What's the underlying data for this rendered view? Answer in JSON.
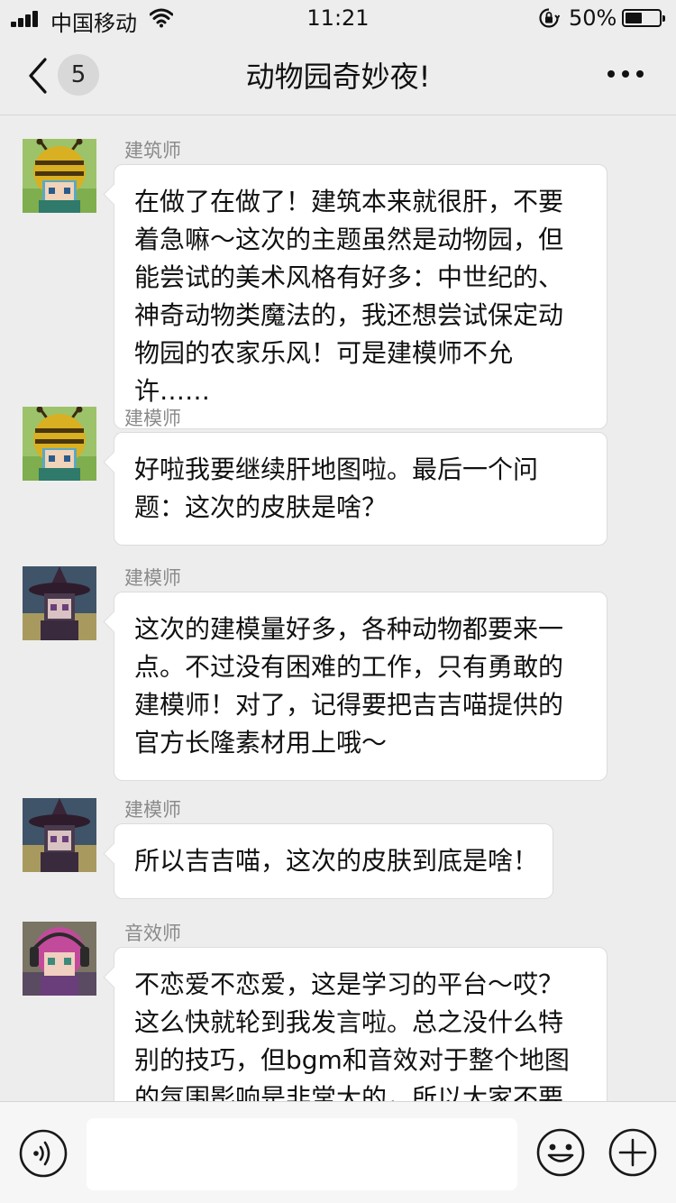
{
  "status_bar": {
    "carrier": "中国移动",
    "time": "11:21",
    "battery_percent": "50%",
    "battery_level": 0.5,
    "icons": [
      "signal-icon",
      "wifi-icon",
      "orientation-lock-icon",
      "battery-icon"
    ]
  },
  "nav": {
    "unread_badge": "5",
    "title": "动物园奇妙夜!",
    "icons": [
      "back-chevron-icon",
      "more-dots-icon"
    ]
  },
  "messages": [
    {
      "sender": "建筑师",
      "text": "在做了在做了！建筑本来就很肝，不要着急嘛～这次的主题虽然是动物园，但能尝试的美术风格有好多：中世纪的、神奇动物类魔法的，我还想尝试保定动物园的农家乐风！可是建模师不允许……",
      "avatar": "bee-helmet-avatar"
    },
    {
      "sender": "建模师",
      "text": "好啦我要继续肝地图啦。最后一个问题：这次的皮肤是啥？",
      "avatar": "bee-helmet-avatar"
    },
    {
      "sender": "建模师",
      "text": "这次的建模量好多，各种动物都要来一点。不过没有困难的工作，只有勇敢的建模师！对了，记得要把吉吉喵提供的官方长隆素材用上哦～",
      "avatar": "witch-hat-avatar"
    },
    {
      "sender": "建模师",
      "text": "所以吉吉喵，这次的皮肤到底是啥！",
      "avatar": "witch-hat-avatar"
    },
    {
      "sender": "音效师",
      "text": "不恋爱不恋爱，这是学习的平台～哎？这么快就轮到我发言啦。总之没什么特别的技巧，但bgm和音效对于整个地图的氛围影响是非常大的，所以大家不要掉以轻",
      "avatar": "headphones-avatar"
    }
  ],
  "input_bar": {
    "placeholder": "",
    "icons": [
      "voice-icon",
      "emoji-icon",
      "plus-icon"
    ]
  }
}
